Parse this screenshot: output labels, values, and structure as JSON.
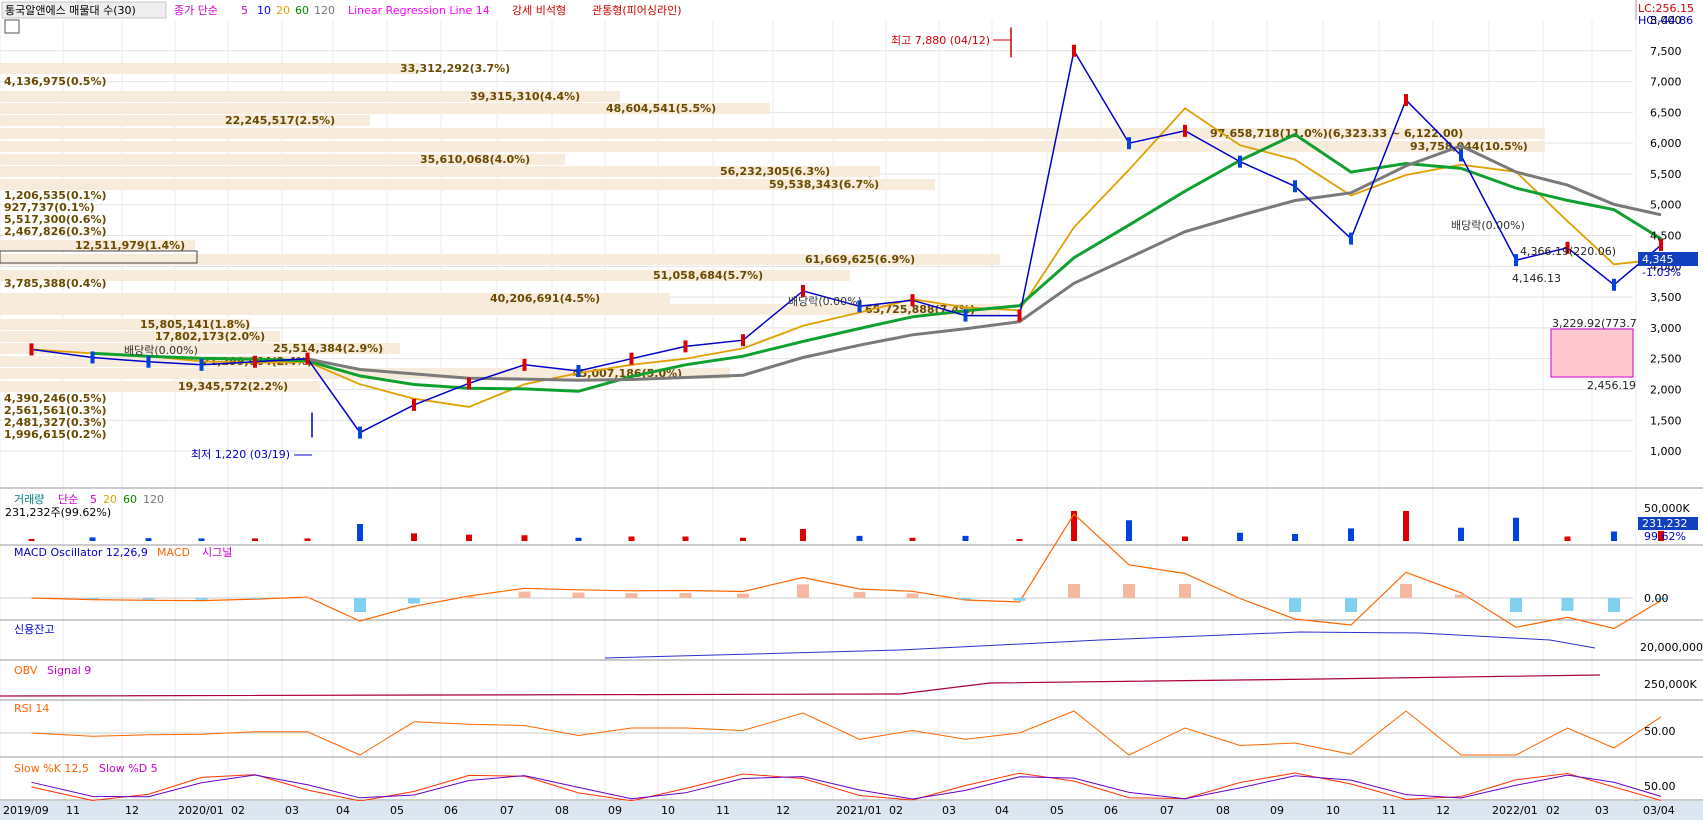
{
  "legend": {
    "title": "통국알앤에스 매물대 수(30)",
    "price_label": "종가 단순",
    "ma_periods": [
      "5",
      "10",
      "20",
      "60",
      "120"
    ],
    "lr_label": "Linear Regression Line 14",
    "strong_label": "강세 비석형",
    "pierce_label": "관통형(피어싱라인)"
  },
  "corner": {
    "lc": "LC:256.15",
    "hc": "HC:-44.86"
  },
  "panels": {
    "volume": {
      "title": "거래량",
      "ma_label": "단순",
      "ma_periods": [
        "5",
        "20",
        "60",
        "120"
      ],
      "value": "231,232주(99.62%)",
      "axis": [
        "50,000K"
      ],
      "badge": "231,232",
      "badge_pct": "99.62%"
    },
    "macd": {
      "title": "MACD Oscillator 12,26,9",
      "macd_label": "MACD",
      "signal_label": "시그널",
      "axis": [
        "0.00"
      ]
    },
    "credit": {
      "title": "신용잔고",
      "axis": [
        "20,000,000"
      ]
    },
    "obv": {
      "title": "OBV",
      "signal_label": "Signal 9",
      "axis": [
        "250,000K"
      ]
    },
    "rsi": {
      "title": "RSI 14",
      "axis": [
        "50.00"
      ]
    },
    "stoch": {
      "title": "Slow %K 12,5",
      "d_label": "Slow %D 5",
      "axis": [
        "50.00"
      ]
    }
  },
  "x_ticks": [
    "2019/09",
    "11",
    "12",
    "2020/01",
    "02",
    "03",
    "04",
    "05",
    "06",
    "07",
    "08",
    "09",
    "10",
    "11",
    "12",
    "2021/01",
    "02",
    "03",
    "04",
    "05",
    "06",
    "07",
    "08",
    "09",
    "10",
    "11",
    "12",
    "2022/01",
    "02",
    "03",
    "03/04"
  ],
  "price_axis": [
    "7,500",
    "7,000",
    "6,500",
    "6,000",
    "5,500",
    "5,000",
    "4,500",
    "4,000",
    "3,500",
    "3,000",
    "2,500",
    "2,000",
    "1,500",
    "1,000"
  ],
  "price_axis_top": "8,000",
  "current_price": {
    "value": "4,345",
    "change": "-1.03%"
  },
  "annotations": {
    "high": "최고 7,880 (04/12)",
    "low": "최저 1,220 (03/19)",
    "dividend": "배당락(0.00%)",
    "lr_range": "4,366.19(220.06)",
    "lr_low": "4,146.13",
    "box_top": "3,229.92(773.7",
    "box_bottom": "2,456.19"
  },
  "volume_profile": [
    {
      "label": "33,312,292(3.7%)"
    },
    {
      "label": "4,136,975(0.5%)"
    },
    {
      "label": "39,315,310(4.4%)"
    },
    {
      "label": "48,604,541(5.5%)"
    },
    {
      "label": "22,245,517(2.5%)"
    },
    {
      "label": "97,658,718(11.0%)(6,323.33 ~ 6,122.00)"
    },
    {
      "label": "93,758,044(10.5%)"
    },
    {
      "label": "35,610,068(4.0%)"
    },
    {
      "label": "56,232,305(6.3%)"
    },
    {
      "label": "59,538,343(6.7%)"
    },
    {
      "label": "1,206,535(0.1%)"
    },
    {
      "label": "927,737(0.1%)"
    },
    {
      "label": "5,517,300(0.6%)"
    },
    {
      "label": "2,467,826(0.3%)"
    },
    {
      "label": "12,511,979(1.4%)"
    },
    {
      "label": "61,669,625(6.9%)"
    },
    {
      "label": "51,058,684(5.7%)"
    },
    {
      "label": "3,785,388(0.4%)"
    },
    {
      "label": "40,206,691(4.5%)"
    },
    {
      "label": "65,725,888(7.4%)"
    },
    {
      "label": "15,805,141(1.8%)"
    },
    {
      "label": "17,802,173(2.0%)"
    },
    {
      "label": "25,514,384(2.9%)"
    },
    {
      "label": "21,299,064(2.4%)"
    },
    {
      "label": "45,007,186(5.0%)"
    },
    {
      "label": "19,345,572(2.2%)"
    },
    {
      "label": "4,390,246(0.5%)"
    },
    {
      "label": "2,561,561(0.3%)"
    },
    {
      "label": "2,481,327(0.3%)"
    },
    {
      "label": "1,996,615(0.2%)"
    }
  ],
  "chart_data": {
    "type": "line",
    "title": "통국알앤에스",
    "x_range": [
      "2019/09",
      "2022/03/04"
    ],
    "ylim": [
      1000,
      8000
    ],
    "price_close": [
      [
        "2019-09",
        2650
      ],
      [
        "2019-10",
        2520
      ],
      [
        "2019-11",
        2450
      ],
      [
        "2019-12",
        2400
      ],
      [
        "2020-01",
        2450
      ],
      [
        "2020-02",
        2500
      ],
      [
        "2020-03",
        1300
      ],
      [
        "2020-04",
        1750
      ],
      [
        "2020-05",
        2100
      ],
      [
        "2020-06",
        2400
      ],
      [
        "2020-07",
        2300
      ],
      [
        "2020-08",
        2500
      ],
      [
        "2020-09",
        2700
      ],
      [
        "2020-10",
        2800
      ],
      [
        "2020-11",
        3600
      ],
      [
        "2020-12",
        3350
      ],
      [
        "2021-01",
        3450
      ],
      [
        "2021-02",
        3200
      ],
      [
        "2021-03",
        3200
      ],
      [
        "2021-04",
        7500
      ],
      [
        "2021-05",
        6000
      ],
      [
        "2021-06",
        6200
      ],
      [
        "2021-07",
        5700
      ],
      [
        "2021-08",
        5300
      ],
      [
        "2021-09",
        4450
      ],
      [
        "2021-10",
        6700
      ],
      [
        "2021-11",
        5800
      ],
      [
        "2021-12",
        4100
      ],
      [
        "2022-01",
        4300
      ],
      [
        "2022-02",
        3700
      ],
      [
        "2022-03",
        4345
      ]
    ],
    "high": {
      "value": 7880,
      "date": "04/12"
    },
    "low": {
      "value": 1220,
      "date": "03/19"
    },
    "last": 4345,
    "change_pct": -1.03
  }
}
